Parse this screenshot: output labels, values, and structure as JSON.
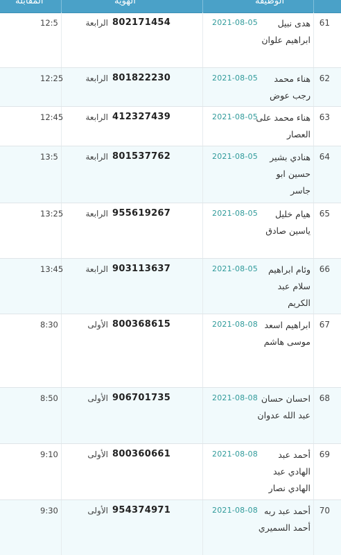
{
  "header": {
    "interview_col": "المقابلة",
    "id_col": "الهوية",
    "job_col": "الوظيفة"
  },
  "rows": [
    {
      "num": "61",
      "name": "هدى نبيل ابراهيم علوان",
      "date": "2021-08-05",
      "id": "802171454",
      "stage": "الرابعة",
      "time": "12:5"
    },
    {
      "num": "62",
      "name": "هناء محمد رجب عوض",
      "date": "2021-08-05",
      "id": "801822230",
      "stage": "الرابعة",
      "time": "12:25"
    },
    {
      "num": "63",
      "name": "هناء محمد على العصار",
      "date": "2021-08-05",
      "id": "412327439",
      "stage": "الرابعة",
      "time": "12:45"
    },
    {
      "num": "64",
      "name": "هنادي بشير حسين ابو جاسر",
      "date": "2021-08-05",
      "id": "801537762",
      "stage": "الرابعة",
      "time": "13:5"
    },
    {
      "num": "65",
      "name": "هيام خليل ياسين صادق",
      "date": "2021-08-05",
      "id": "955619267",
      "stage": "الرابعة",
      "time": "13:25"
    },
    {
      "num": "66",
      "name": "وئام ابراهيم سلام عبد الكريم",
      "date": "2021-08-05",
      "id": "903113637",
      "stage": "الرابعة",
      "time": "13:45"
    },
    {
      "num": "67",
      "name": "ابراهيم اسعد موسى هاشم",
      "date": "2021-08-08",
      "id": "800368615",
      "stage": "الأولى",
      "time": "8:30"
    },
    {
      "num": "68",
      "name": "احسان حسان عبد الله عدوان",
      "date": "2021-08-08",
      "id": "906701735",
      "stage": "الأولى",
      "time": "8:50"
    },
    {
      "num": "69",
      "name": "أحمد عبد الهادي عبد الهادي نصار",
      "date": "2021-08-08",
      "id": "800360661",
      "stage": "الأولى",
      "time": "9:10"
    },
    {
      "num": "70",
      "name": "أحمد عبد ربه أحمد السميري",
      "date": "2021-08-08",
      "id": "954374971",
      "stage": "الأولى",
      "time": "9:30"
    }
  ]
}
